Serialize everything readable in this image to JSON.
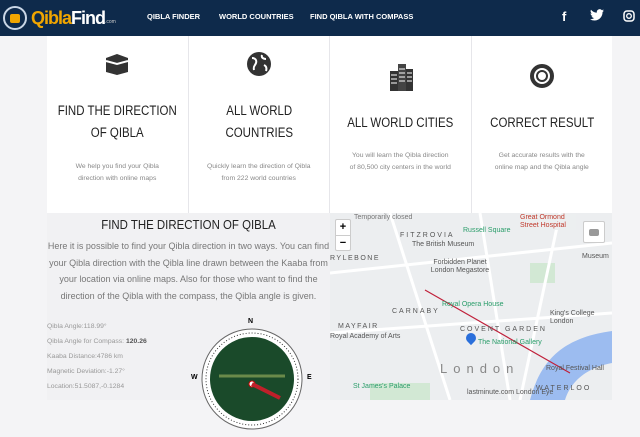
{
  "header": {
    "logo_q": "Qibla",
    "logo_f": "Find",
    "logo_c": ".com",
    "nav": [
      "QIBLA FINDER",
      "WORLD COUNTRIES",
      "FIND QIBLA WITH COMPASS"
    ],
    "social": {
      "facebook": "f",
      "twitter": "t",
      "instagram": "ig"
    }
  },
  "cards": [
    {
      "icon": "kaaba-icon",
      "title1": "FIND THE DIRECTION",
      "title2": "OF QIBLA",
      "text1": "We help you find your Qibla",
      "text2": "direction with online maps"
    },
    {
      "icon": "globe-icon",
      "title1": "ALL WORLD",
      "title2": "COUNTRIES",
      "text1": "Quickly learn the direction of Qibla",
      "text2": "from 222 world countries"
    },
    {
      "icon": "buildings-icon",
      "title1": "ALL WORLD CITIES",
      "title2": "",
      "text1": "You will learn the Qibla direction",
      "text2": "of 80,500 city centers in the world"
    },
    {
      "icon": "lifebuoy-icon",
      "title1": "CORRECT RESULT",
      "title2": "",
      "text1": "Get accurate results with the",
      "text2": "online map and the Qibla angle"
    }
  ],
  "section": {
    "title": "FIND THE DIRECTION OF QIBLA",
    "description": "Here it is possible to find your Qibla direction in two ways. You can find your Qibla direction with the Qibla line drawn between the Kaaba from your location via online maps. Also for those who want to find the direction of the Qibla with the compass, the Qibla angle is given.",
    "info": {
      "angle": "Qibla Angle:118.99°",
      "compass_label": "Qibla Angle for Compass: ",
      "compass_value": "120.26",
      "distance": "Kaaba Distance:4786 km",
      "magnetic": "Magnetic Deviation:-1.27°",
      "location": "Location:51.5087,-0.1284"
    },
    "compass": {
      "n": "N",
      "w": "W",
      "e": "E"
    }
  },
  "map": {
    "zoom_in": "+",
    "zoom_out": "−",
    "labels": [
      "Great Ormond Street Hospital",
      "FITZROVIA",
      "Russell Square",
      "The British Museum",
      "RYLEBONE",
      "Forbidden Planet London Megastore",
      "Royal Opera House",
      "CARNABY",
      "COVENT GARDEN",
      "King's College London",
      "MAYFAIR",
      "Royal Academy of Arts",
      "The National Gallery",
      "London",
      "Royal Festival Hall",
      "St James's Palace",
      "lastminute.com London Eye",
      "WATERLOO",
      "Museum",
      "Temporarily closed"
    ]
  }
}
